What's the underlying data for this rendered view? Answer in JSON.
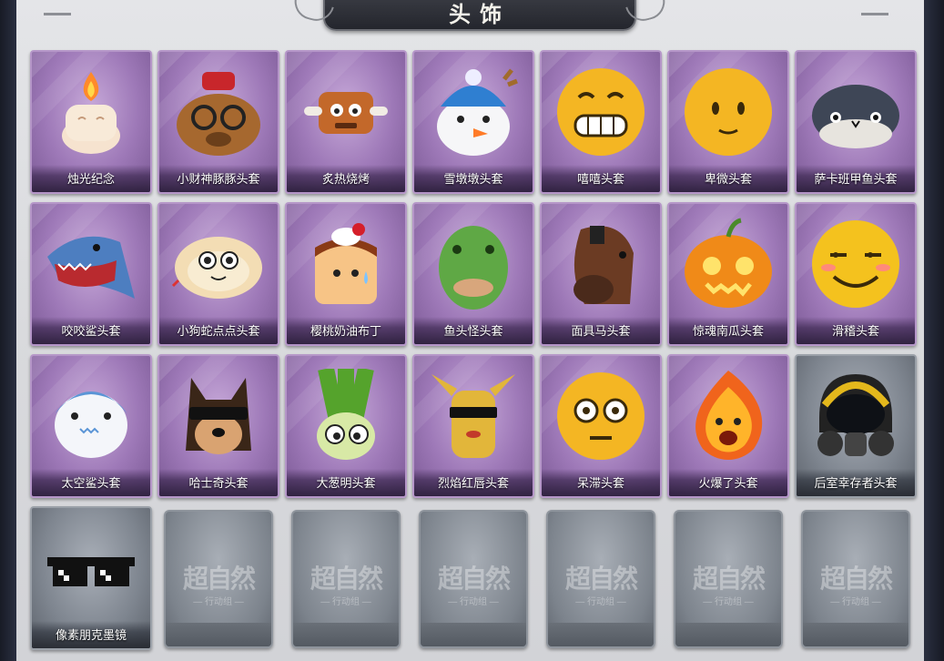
{
  "header": {
    "title": "头饰"
  },
  "items": [
    {
      "label": "烛光纪念",
      "style": "purple",
      "icon": "candle-icon"
    },
    {
      "label": "小财神豚豚头套",
      "style": "purple",
      "icon": "capybara-god-of-wealth-icon"
    },
    {
      "label": "炙热烧烤",
      "style": "purple",
      "icon": "grilled-meat-icon"
    },
    {
      "label": "雪墩墩头套",
      "style": "purple",
      "icon": "snowman-reindeer-icon"
    },
    {
      "label": "嘻嘻头套",
      "style": "purple",
      "icon": "grinning-emoji-icon"
    },
    {
      "label": "卑微头套",
      "style": "purple",
      "icon": "humble-emoji-icon"
    },
    {
      "label": "萨卡班甲鱼头套",
      "style": "purple",
      "icon": "sacabambaspis-fish-icon"
    },
    {
      "label": "咬咬鲨头套",
      "style": "purple",
      "icon": "biting-shark-icon"
    },
    {
      "label": "小狗蛇点点头套",
      "style": "purple",
      "icon": "cute-snake-icon"
    },
    {
      "label": "樱桃奶油布丁",
      "style": "purple",
      "icon": "cherry-pudding-icon"
    },
    {
      "label": "鱼头怪头套",
      "style": "purple",
      "icon": "fish-head-monster-icon"
    },
    {
      "label": "面具马头套",
      "style": "purple",
      "icon": "horse-mask-icon"
    },
    {
      "label": "惊魂南瓜头套",
      "style": "purple",
      "icon": "jack-o-lantern-icon"
    },
    {
      "label": "滑稽头套",
      "style": "purple",
      "icon": "smirk-emoji-icon"
    },
    {
      "label": "太空鲨头套",
      "style": "purple",
      "icon": "space-shark-icon"
    },
    {
      "label": "哈士奇头套",
      "style": "purple",
      "icon": "husky-sunglasses-icon"
    },
    {
      "label": "大葱明头套",
      "style": "purple",
      "icon": "green-onion-icon"
    },
    {
      "label": "烈焰红唇头套",
      "style": "purple",
      "icon": "yellow-mouse-sunglasses-icon"
    },
    {
      "label": "呆滞头套",
      "style": "purple",
      "icon": "dazed-emoji-icon"
    },
    {
      "label": "火爆了头套",
      "style": "purple",
      "icon": "fire-spirit-icon"
    },
    {
      "label": "后室幸存者头套",
      "style": "gray",
      "icon": "gas-mask-helmet-icon"
    },
    {
      "label": "像素朋克墨镜",
      "style": "gray",
      "icon": "pixel-sunglasses-icon"
    },
    {
      "label": "",
      "style": "empty",
      "icon": "locked-slot-icon"
    },
    {
      "label": "",
      "style": "empty",
      "icon": "locked-slot-icon"
    },
    {
      "label": "",
      "style": "empty",
      "icon": "locked-slot-icon"
    },
    {
      "label": "",
      "style": "empty",
      "icon": "locked-slot-icon"
    },
    {
      "label": "",
      "style": "empty",
      "icon": "locked-slot-icon"
    },
    {
      "label": "",
      "style": "empty",
      "icon": "locked-slot-icon"
    }
  ],
  "watermark": {
    "main": "超自然",
    "sub": "行动组"
  }
}
